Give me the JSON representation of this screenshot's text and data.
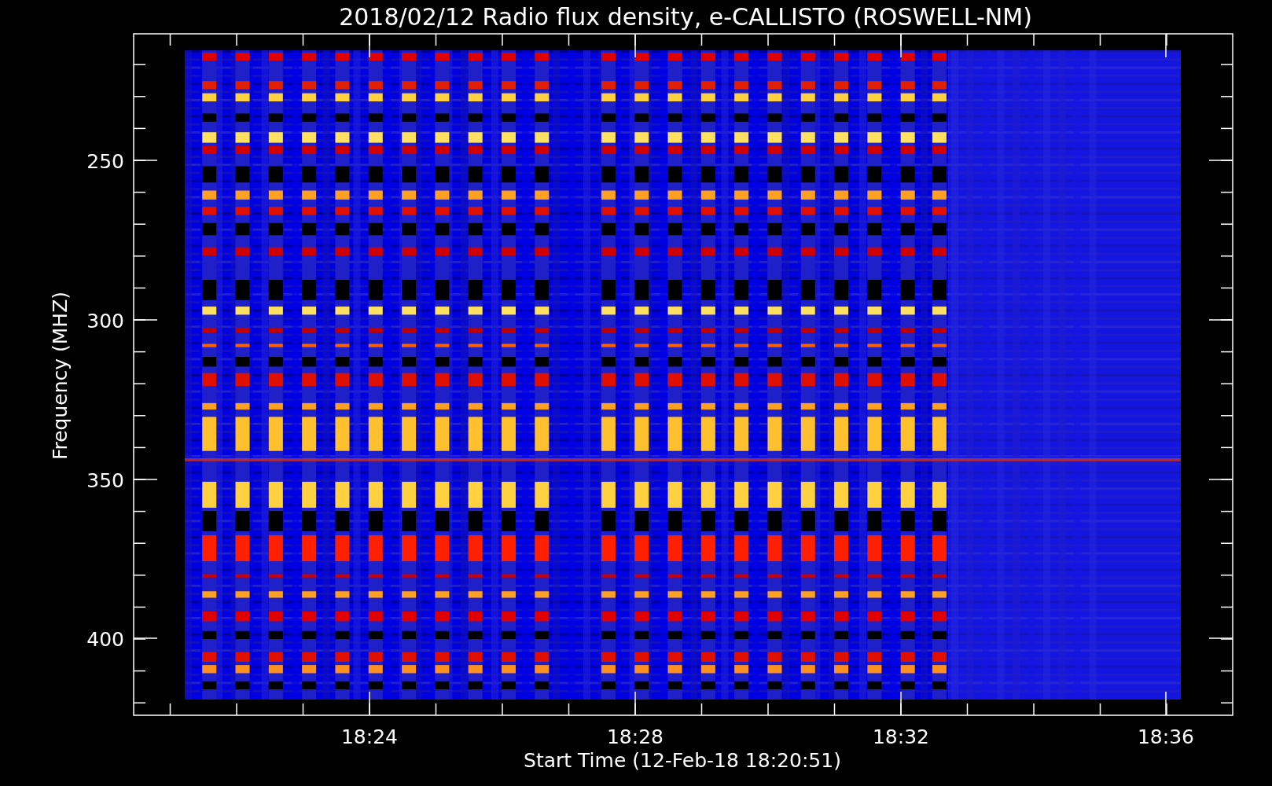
{
  "title": "2018/02/12  Radio flux density, e-CALLISTO (ROSWELL-NM)",
  "y_axis": {
    "label": "Frequency (MHZ)",
    "ticks": [
      "250",
      "300",
      "350",
      "400"
    ]
  },
  "x_axis": {
    "label": "Start Time (12-Feb-18 18:20:51)",
    "ticks": [
      "18:24",
      "18:28",
      "18:32",
      "18:36"
    ]
  }
}
